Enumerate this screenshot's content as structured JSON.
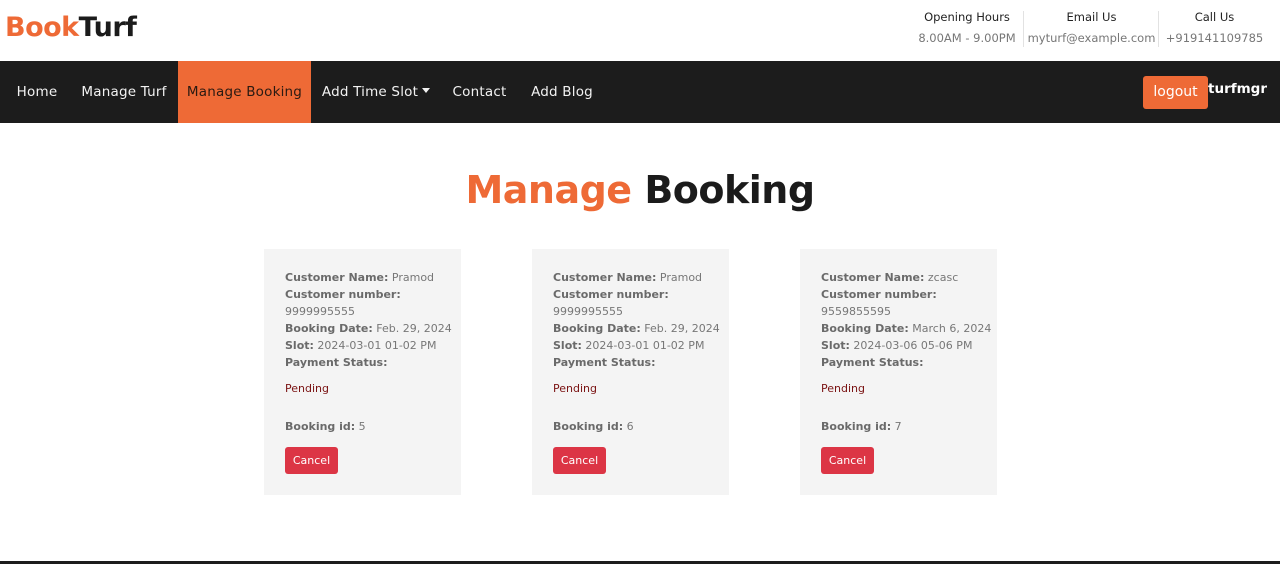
{
  "brand": {
    "part1": "Book",
    "part2": "Turf"
  },
  "header_info": [
    {
      "title": "Opening Hours",
      "value": "8.00AM - 9.00PM"
    },
    {
      "title": "Email Us",
      "value": "myturf@example.com"
    },
    {
      "title": "Call Us",
      "value": "+919141109785"
    }
  ],
  "nav": {
    "items": [
      "Home",
      "Manage Turf",
      "Manage Booking",
      "Add Time Slot",
      "Contact",
      "Add Blog"
    ],
    "active": "Manage Booking",
    "logout_label": "logout",
    "username": "turfmgr"
  },
  "page_title": {
    "part1": "Manage",
    "part2": "Booking"
  },
  "labels": {
    "customer_name": "Customer Name:",
    "customer_number": "Customer number:",
    "booking_date": "Booking Date:",
    "slot": "Slot:",
    "payment_status": "Payment Status:",
    "booking_id": "Booking id:",
    "cancel": "Cancel"
  },
  "bookings": [
    {
      "customer_name": "Pramod",
      "customer_number": "9999995555",
      "booking_date": "Feb. 29, 2024",
      "slot": "2024-03-01 01-02 PM",
      "payment_status": "Pending",
      "booking_id": "5"
    },
    {
      "customer_name": "Pramod",
      "customer_number": "9999995555",
      "booking_date": "Feb. 29, 2024",
      "slot": "2024-03-01 01-02 PM",
      "payment_status": "Pending",
      "booking_id": "6"
    },
    {
      "customer_name": "zcasc",
      "customer_number": "9559855595",
      "booking_date": "March 6, 2024",
      "slot": "2024-03-06 05-06 PM",
      "payment_status": "Pending",
      "booking_id": "7"
    }
  ],
  "colors": {
    "accent": "#ee6a36",
    "dark": "#1c1c1c",
    "danger": "#dc3545",
    "pending": "#7a1212"
  }
}
